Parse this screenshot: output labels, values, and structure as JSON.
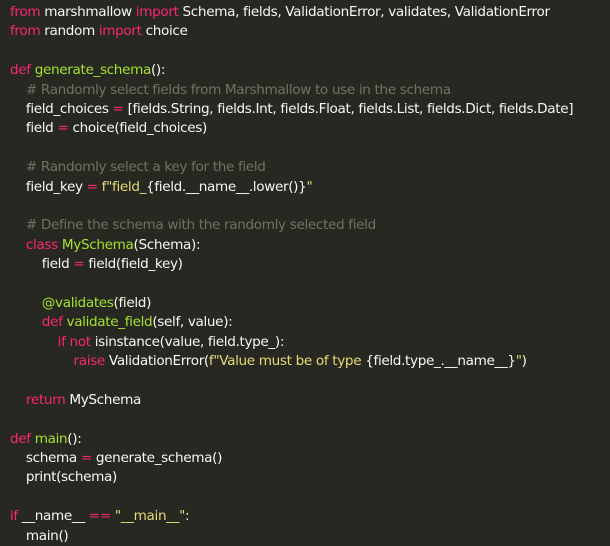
{
  "editor": {
    "language": "python",
    "colors": {
      "background": "#272822",
      "default": "#f8f8f2",
      "keyword": "#f92672",
      "function": "#a6e22e",
      "comment": "#75715e",
      "string": "#e6db74"
    },
    "lines": [
      [
        {
          "t": "kw",
          "v": "from"
        },
        {
          "t": "tx",
          "v": " marshmallow "
        },
        {
          "t": "kw",
          "v": "import"
        },
        {
          "t": "tx",
          "v": " Schema, fields, ValidationError, validates, ValidationError"
        }
      ],
      [
        {
          "t": "kw",
          "v": "from"
        },
        {
          "t": "tx",
          "v": " random "
        },
        {
          "t": "kw",
          "v": "import"
        },
        {
          "t": "tx",
          "v": " choice"
        }
      ],
      [],
      [
        {
          "t": "kw",
          "v": "def"
        },
        {
          "t": "tx",
          "v": " "
        },
        {
          "t": "fn",
          "v": "generate_schema"
        },
        {
          "t": "tx",
          "v": "():"
        }
      ],
      [
        {
          "t": "tx",
          "v": "    "
        },
        {
          "t": "cm",
          "v": "# Randomly select fields from Marshmallow to use in the schema"
        }
      ],
      [
        {
          "t": "tx",
          "v": "    field_choices "
        },
        {
          "t": "kw",
          "v": "="
        },
        {
          "t": "tx",
          "v": " [fields.String, fields.Int, fields.Float, fields.List, fields.Dict, fields.Date]"
        }
      ],
      [
        {
          "t": "tx",
          "v": "    field "
        },
        {
          "t": "kw",
          "v": "="
        },
        {
          "t": "tx",
          "v": " choice(field_choices)"
        }
      ],
      [],
      [
        {
          "t": "tx",
          "v": "    "
        },
        {
          "t": "cm",
          "v": "# Randomly select a key for the field"
        }
      ],
      [
        {
          "t": "tx",
          "v": "    field_key "
        },
        {
          "t": "kw",
          "v": "="
        },
        {
          "t": "tx",
          "v": " "
        },
        {
          "t": "st",
          "v": "f\"field_"
        },
        {
          "t": "tx",
          "v": "{field.__name__.lower()}"
        },
        {
          "t": "st",
          "v": "\""
        }
      ],
      [],
      [
        {
          "t": "tx",
          "v": "    "
        },
        {
          "t": "cm",
          "v": "# Define the schema with the randomly selected field"
        }
      ],
      [
        {
          "t": "tx",
          "v": "    "
        },
        {
          "t": "kw",
          "v": "class"
        },
        {
          "t": "tx",
          "v": " "
        },
        {
          "t": "fn",
          "v": "MySchema"
        },
        {
          "t": "tx",
          "v": "(Schema):"
        }
      ],
      [
        {
          "t": "tx",
          "v": "        field "
        },
        {
          "t": "kw",
          "v": "="
        },
        {
          "t": "tx",
          "v": " field(field_key)"
        }
      ],
      [],
      [
        {
          "t": "tx",
          "v": "        "
        },
        {
          "t": "fn",
          "v": "@validates"
        },
        {
          "t": "tx",
          "v": "(field)"
        }
      ],
      [
        {
          "t": "tx",
          "v": "        "
        },
        {
          "t": "kw",
          "v": "def"
        },
        {
          "t": "tx",
          "v": " "
        },
        {
          "t": "fn",
          "v": "validate_field"
        },
        {
          "t": "tx",
          "v": "(self, value):"
        }
      ],
      [
        {
          "t": "tx",
          "v": "            "
        },
        {
          "t": "kw",
          "v": "if"
        },
        {
          "t": "tx",
          "v": " "
        },
        {
          "t": "kw",
          "v": "not"
        },
        {
          "t": "tx",
          "v": " isinstance(value, field.type_):"
        }
      ],
      [
        {
          "t": "tx",
          "v": "                "
        },
        {
          "t": "kw",
          "v": "raise"
        },
        {
          "t": "tx",
          "v": " ValidationError("
        },
        {
          "t": "st",
          "v": "f\"Value must be of type "
        },
        {
          "t": "tx",
          "v": "{field.type_.__name__}"
        },
        {
          "t": "st",
          "v": "\""
        },
        {
          "t": "tx",
          "v": ")"
        }
      ],
      [],
      [
        {
          "t": "tx",
          "v": "    "
        },
        {
          "t": "kw",
          "v": "return"
        },
        {
          "t": "tx",
          "v": " MySchema"
        }
      ],
      [],
      [
        {
          "t": "kw",
          "v": "def"
        },
        {
          "t": "tx",
          "v": " "
        },
        {
          "t": "fn",
          "v": "main"
        },
        {
          "t": "tx",
          "v": "():"
        }
      ],
      [
        {
          "t": "tx",
          "v": "    schema "
        },
        {
          "t": "kw",
          "v": "="
        },
        {
          "t": "tx",
          "v": " generate_schema()"
        }
      ],
      [
        {
          "t": "tx",
          "v": "    print(schema)"
        }
      ],
      [],
      [
        {
          "t": "kw",
          "v": "if"
        },
        {
          "t": "tx",
          "v": " __name__ "
        },
        {
          "t": "kw",
          "v": "=="
        },
        {
          "t": "tx",
          "v": " "
        },
        {
          "t": "st",
          "v": "\"__main__\""
        },
        {
          "t": "tx",
          "v": ":"
        }
      ],
      [
        {
          "t": "tx",
          "v": "    main()"
        }
      ]
    ]
  }
}
